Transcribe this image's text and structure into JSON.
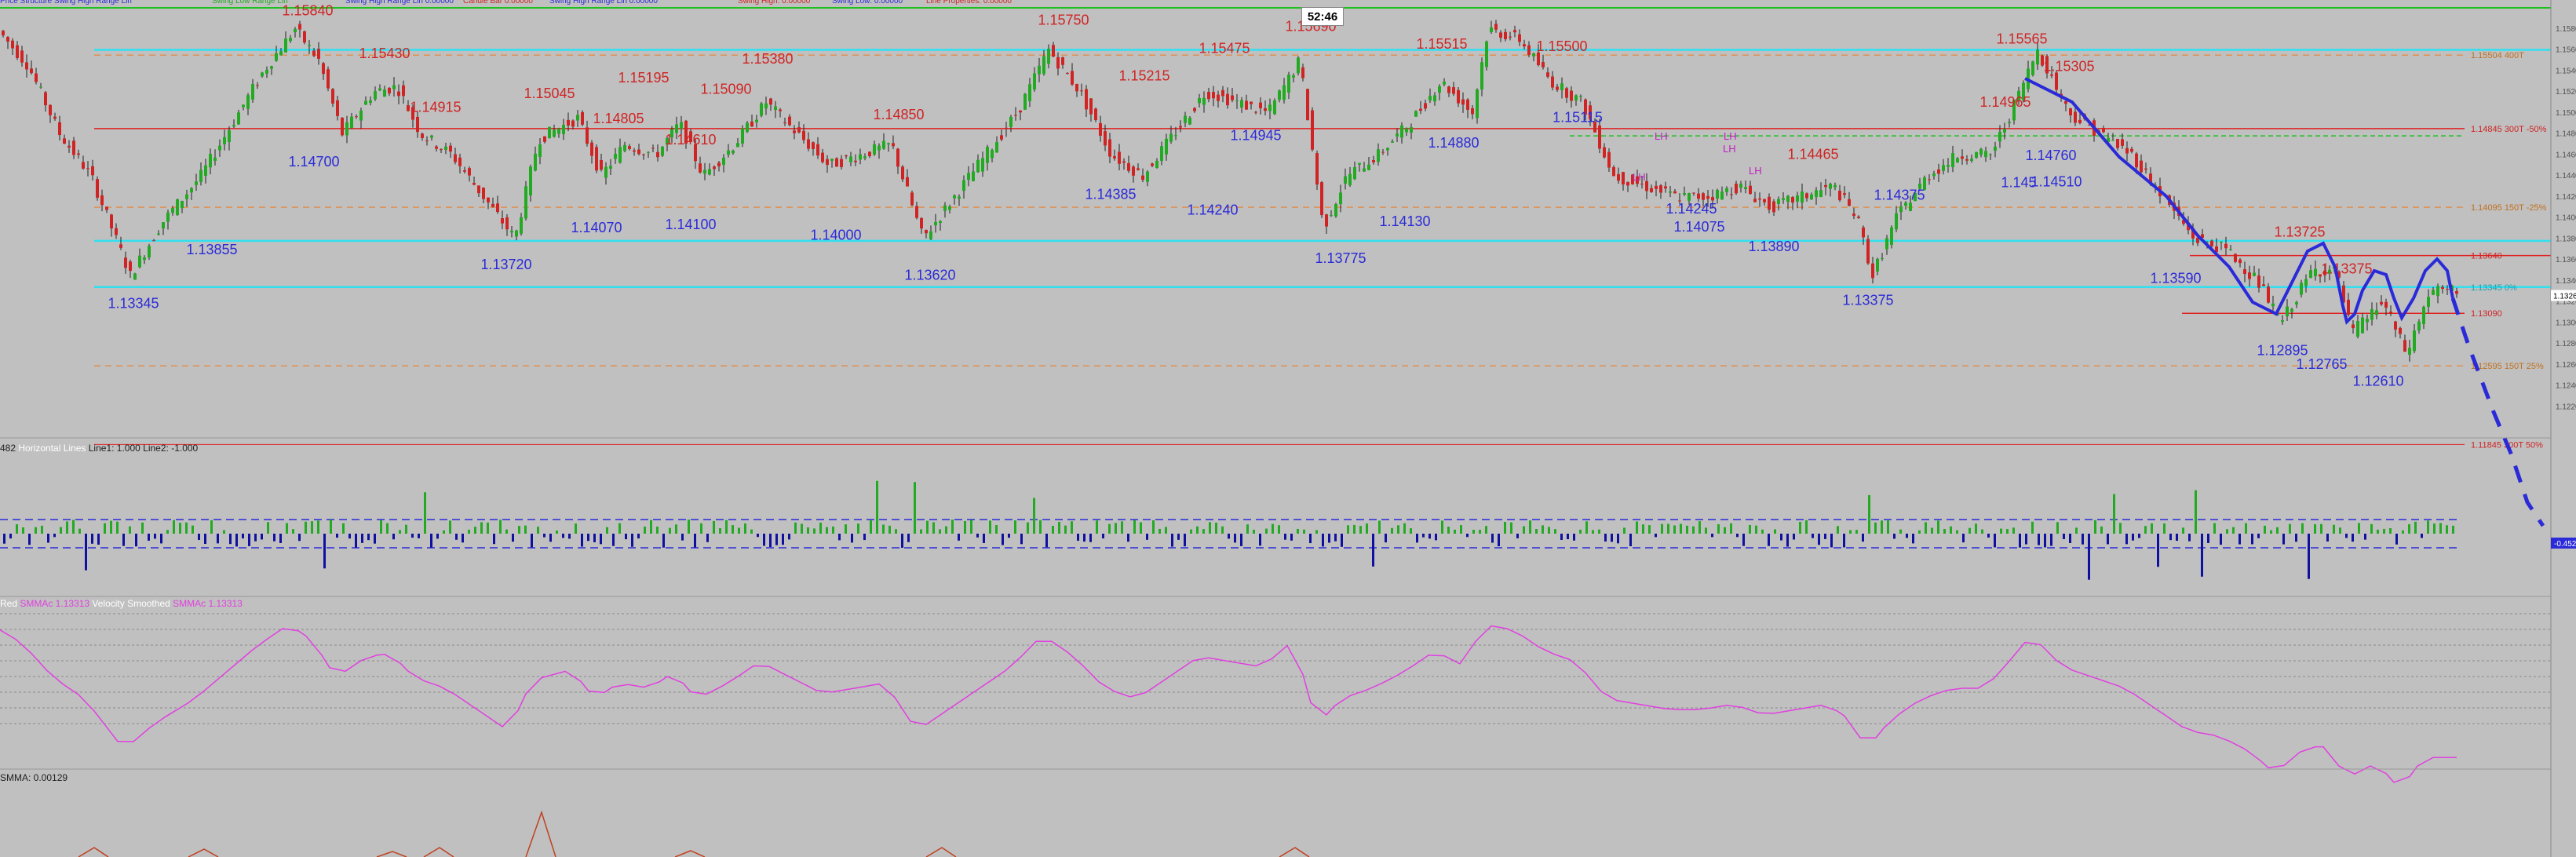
{
  "header": {
    "items": [
      {
        "text": "Price Structure Swing High Range Lin",
        "color": "#2a2ad8"
      },
      {
        "text": "Swing Low Range Lin",
        "color": "#22aa22"
      },
      {
        "text": "Swing High Range Lin 0.00000",
        "color": "#2a2ad8"
      },
      {
        "text": "Candle Bar 0.00000",
        "color": "#d02424"
      },
      {
        "text": "Swing High Range Lin 0.00000",
        "color": "#2a2ad8"
      },
      {
        "text": "Swing High: 0.00000",
        "color": "#d02424"
      },
      {
        "text": "Swing Low: 0.00000",
        "color": "#2a2ad8"
      },
      {
        "text": "Line Properties: 0.00000",
        "color": "#d02424"
      }
    ]
  },
  "timer": {
    "text": "52:46"
  },
  "subpanel1": {
    "label_id": "482",
    "label_text": "Horizontal Lines",
    "line1": "Line1: 1.000",
    "line2": "Line2: -1.000"
  },
  "subpanel2": {
    "label1": "Red",
    "label2": "SMMAc 1.13313",
    "label3": "Velocity Smoothed",
    "label4": "SMMAc 1.13313"
  },
  "subpanel3": {
    "label": "SMMA: 0.00129"
  },
  "colors": {
    "background": "#c0c0c0",
    "bull": "#22aa22",
    "bear": "#d02424",
    "level_red": "#e02020",
    "level_orange": "#e09050",
    "level_cyan": "#30e0f0",
    "level_green": "#20c020",
    "drawing_blue": "#2a2ad8",
    "smma_pink": "#e040e0",
    "smma_cyan": "#40d0e0"
  },
  "chart_data": {
    "type": "candlestick",
    "y_range": [
      1.12,
      1.16
    ],
    "y_ticks": [
      "1.1580",
      "1.1560",
      "1.1540",
      "1.1520",
      "1.1500",
      "1.1480",
      "1.1460",
      "1.1440",
      "1.1420",
      "1.1400",
      "1.1380",
      "1.1360",
      "1.1340",
      "1.1320",
      "1.1300",
      "1.1280",
      "1.1260",
      "1.1240",
      "1.1220"
    ],
    "current_price": "1.1326",
    "swing_labels": [
      {
        "text": "1.15840",
        "type": "high",
        "price": 1.1584
      },
      {
        "text": "1.15430",
        "type": "high",
        "price": 1.1543
      },
      {
        "text": "1.14700",
        "type": "low",
        "price": 1.147
      },
      {
        "text": "1.14915",
        "type": "high",
        "price": 1.1492
      },
      {
        "text": "1.13855",
        "type": "low",
        "price": 1.1386
      },
      {
        "text": "1.13345",
        "type": "low",
        "price": 1.1335
      },
      {
        "text": "1.15045",
        "type": "high",
        "price": 1.1505
      },
      {
        "text": "1.14805",
        "type": "high",
        "price": 1.1481
      },
      {
        "text": "1.15195",
        "type": "high",
        "price": 1.152
      },
      {
        "text": "1.14610",
        "type": "high",
        "price": 1.1461
      },
      {
        "text": "1.15090",
        "type": "high",
        "price": 1.1509
      },
      {
        "text": "1.15380",
        "type": "high",
        "price": 1.1538
      },
      {
        "text": "1.14070",
        "type": "low",
        "price": 1.1407
      },
      {
        "text": "1.14100",
        "type": "low",
        "price": 1.141
      },
      {
        "text": "1.13720",
        "type": "low",
        "price": 1.1372
      },
      {
        "text": "1.14850",
        "type": "high",
        "price": 1.1485
      },
      {
        "text": "1.14000",
        "type": "low",
        "price": 1.14
      },
      {
        "text": "1.13620",
        "type": "low",
        "price": 1.1362
      },
      {
        "text": "1.15750",
        "type": "high",
        "price": 1.1575
      },
      {
        "text": "1.15215",
        "type": "high",
        "price": 1.1522
      },
      {
        "text": "1.14385",
        "type": "low",
        "price": 1.1439
      },
      {
        "text": "1.15475",
        "type": "high",
        "price": 1.1548
      },
      {
        "text": "1.14240",
        "type": "low",
        "price": 1.1424
      },
      {
        "text": "1.14945",
        "type": "low",
        "price": 1.1495
      },
      {
        "text": "1.15690",
        "type": "high",
        "price": 1.1569
      },
      {
        "text": "1.13775",
        "type": "low",
        "price": 1.1378
      },
      {
        "text": "1.14130",
        "type": "low",
        "price": 1.1413
      },
      {
        "text": "1.15515",
        "type": "high",
        "price": 1.1552
      },
      {
        "text": "1.14880",
        "type": "low",
        "price": 1.1488
      },
      {
        "text": "1.15500",
        "type": "high",
        "price": 1.155
      },
      {
        "text": "1.15115",
        "type": "low",
        "price": 1.1512
      },
      {
        "text": "1.14245",
        "type": "low",
        "price": 1.1425
      },
      {
        "text": "1.14075",
        "type": "low",
        "price": 1.1408
      },
      {
        "text": "1.13890",
        "type": "low",
        "price": 1.1389
      },
      {
        "text": "1.14465",
        "type": "high",
        "price": 1.1447
      },
      {
        "text": "1.13375",
        "type": "low",
        "price": 1.1338
      },
      {
        "text": "1.14375",
        "type": "low",
        "price": 1.1438
      },
      {
        "text": "1.14965",
        "type": "high",
        "price": 1.1497
      },
      {
        "text": "1.145",
        "type": "low",
        "price": 1.145
      },
      {
        "text": "1.14510",
        "type": "low",
        "price": 1.1451
      },
      {
        "text": "1.15565",
        "type": "high",
        "price": 1.1557
      },
      {
        "text": "1.15305",
        "type": "high",
        "price": 1.1531
      },
      {
        "text": "1.14760",
        "type": "low",
        "price": 1.1476
      },
      {
        "text": "1.13590",
        "type": "low",
        "price": 1.1359
      },
      {
        "text": "1.13725",
        "type": "high",
        "price": 1.1373
      },
      {
        "text": "1.12895",
        "type": "low",
        "price": 1.129
      },
      {
        "text": "1.13375",
        "type": "high",
        "price": 1.1338
      },
      {
        "text": "1.12765",
        "type": "low",
        "price": 1.1277
      },
      {
        "text": "1.12610",
        "type": "low",
        "price": 1.1261
      }
    ],
    "levels": [
      {
        "price": 1.156,
        "style": "cyan",
        "label": ""
      },
      {
        "price": 1.1555,
        "style": "orange-dash",
        "label": "1.15504 400T"
      },
      {
        "price": 1.1485,
        "style": "red",
        "label": "1.14845 300T -50%"
      },
      {
        "price": 1.1478,
        "style": "green-dash",
        "label": ""
      },
      {
        "price": 1.141,
        "style": "orange-dash",
        "label": "1.14095 150T -25%"
      },
      {
        "price": 1.1378,
        "style": "cyan",
        "label": ""
      },
      {
        "price": 1.1364,
        "style": "red",
        "label": "1.13640"
      },
      {
        "price": 1.1334,
        "style": "cyan",
        "label": "1.13345 0%"
      },
      {
        "price": 1.1309,
        "style": "red",
        "label": "1.13090"
      },
      {
        "price": 1.1259,
        "style": "orange-dash",
        "label": "1.12595 150T 25%"
      },
      {
        "price": 1.1184,
        "style": "red",
        "label": "1.11845 300T 50%"
      }
    ],
    "lh_marks": [
      "LH",
      "LH",
      "LH",
      "LH",
      "LH"
    ]
  }
}
